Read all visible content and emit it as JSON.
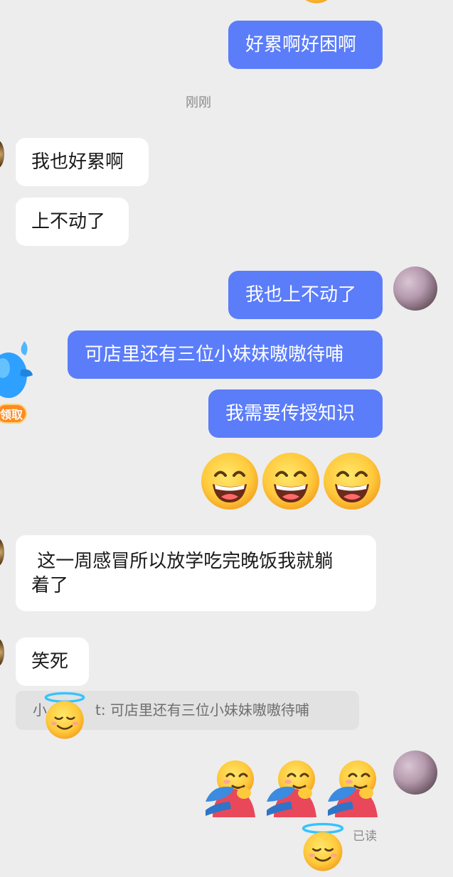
{
  "timestamp": "刚刚",
  "messages": {
    "m1": "好累啊好困啊",
    "m2": "我也好累啊",
    "m3": "上不动了",
    "m4": "我也上不动了",
    "m5": "可店里还有三位小妹妹嗷嗷待哺",
    "m6": "我需要传授知识",
    "m7_line1": " 这一周感冒所以放学吃完晚饭我就躺",
    "m7_line2": "着了",
    "m8": "笑死"
  },
  "reply_quote": {
    "prefix": "小",
    "suffix": "t: 可店里还有三位小妹妹嗷嗷待哺"
  },
  "floating_badge": "领取",
  "read_status": "已读",
  "emoji_rows": {
    "grin": [
      "grinning-face-icon",
      "grinning-face-icon",
      "grinning-face-icon"
    ],
    "hug": [
      "hugging-face-icon",
      "hugging-face-icon",
      "hugging-face-icon"
    ]
  },
  "colors": {
    "background": "#ededed",
    "outgoing_bubble": "#5b7dfa",
    "incoming_bubble": "#ffffff",
    "badge": "#ff8a1f",
    "mascot": "#2ea0ff"
  }
}
